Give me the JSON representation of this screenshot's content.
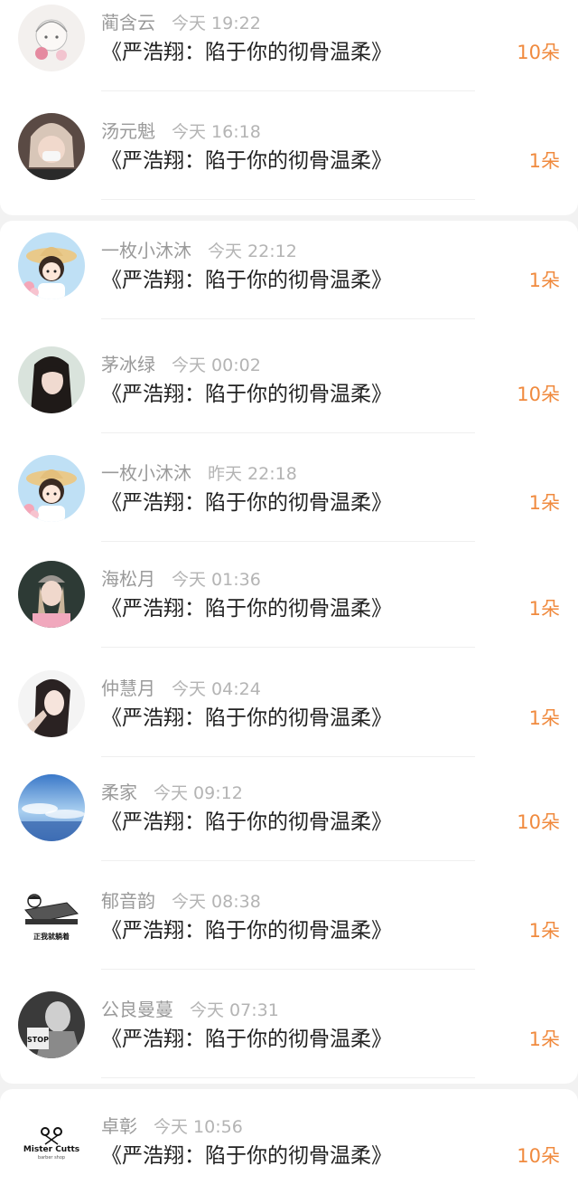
{
  "items": [
    {
      "name": "蔺含云",
      "time": "今天 19:22",
      "title": "《严浩翔：陷于你的彻骨温柔》",
      "count": "10朵",
      "avatar": "sketch-girl-avatar-icon"
    },
    {
      "name": "汤元魁",
      "time": "今天 16:18",
      "title": "《严浩翔：陷于你的彻骨温柔》",
      "count": "1朵",
      "avatar": "masked-girl-avatar-icon"
    },
    {
      "name": "一枚小沐沐",
      "time": "今天 22:12",
      "title": "《严浩翔：陷于你的彻骨温柔》",
      "count": "1朵",
      "avatar": "cartoon-girl-hat-avatar-icon"
    },
    {
      "name": "茅冰绿",
      "time": "今天 00:02",
      "title": "《严浩翔：陷于你的彻骨温柔》",
      "count": "10朵",
      "avatar": "girl-portrait-avatar-icon"
    },
    {
      "name": "一枚小沐沐",
      "time": "昨天 22:18",
      "title": "《严浩翔：陷于你的彻骨温柔》",
      "count": "1朵",
      "avatar": "cartoon-girl-hat-avatar-icon"
    },
    {
      "name": "海松月",
      "time": "今天 01:36",
      "title": "《严浩翔：陷于你的彻骨温柔》",
      "count": "1朵",
      "avatar": "beanie-girl-avatar-icon"
    },
    {
      "name": "仲慧月",
      "time": "今天 04:24",
      "title": "《严浩翔：陷于你的彻骨温柔》",
      "count": "1朵",
      "avatar": "selfie-girl-avatar-icon"
    },
    {
      "name": "柔家",
      "time": "今天 09:12",
      "title": "《严浩翔：陷于你的彻骨温柔》",
      "count": "10朵",
      "avatar": "blue-sky-avatar-icon"
    },
    {
      "name": "郁音韵",
      "time": "今天 08:38",
      "title": "《严浩翔：陷于你的彻骨温柔》",
      "count": "1朵",
      "avatar": "lying-in-bed-meme-avatar-icon",
      "avatar_caption": "正我就躺着"
    },
    {
      "name": "公良曼蔓",
      "time": "今天 07:31",
      "title": "《严浩翔：陷于你的彻骨温柔》",
      "count": "1朵",
      "avatar": "bw-stop-sign-avatar-icon",
      "avatar_caption": "STOP"
    },
    {
      "name": "卓彰",
      "time": "今天 10:56",
      "title": "《严浩翔：陷于你的彻骨温柔》",
      "count": "10朵",
      "avatar": "mister-cutts-logo-avatar-icon",
      "avatar_caption": "Mister Cutts",
      "avatar_subcaption": "barber shop"
    }
  ],
  "colors": {
    "count": "#f08a3e",
    "name": "#9a9a9a",
    "title": "#222222",
    "background": "#f2f2f2"
  }
}
